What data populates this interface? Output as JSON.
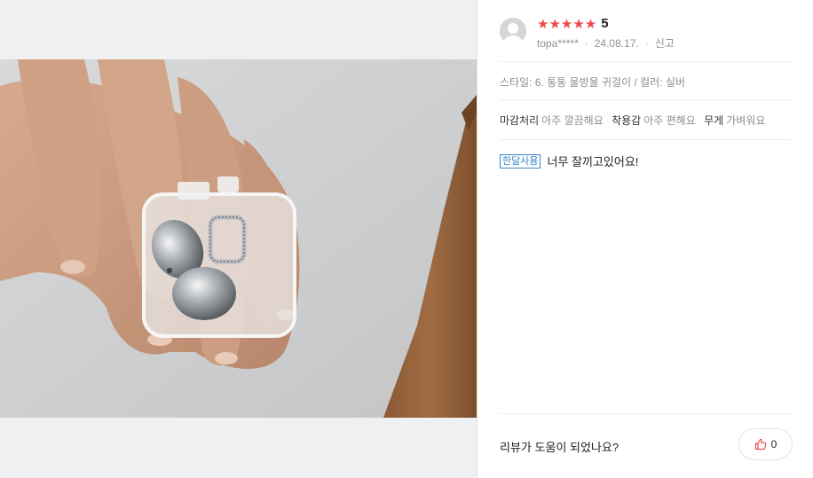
{
  "review": {
    "rating_stars": "★★★★★",
    "rating_value": "5",
    "reviewer": "topa*****",
    "date": "24.08.17.",
    "report_label": "신고",
    "option": "스타일: 6. 통통 물방울 귀걸이 / 컬러: 실버",
    "evaluations": [
      {
        "key": "마감처리",
        "value": "아주 깔끔해요"
      },
      {
        "key": "착용감",
        "value": "아주 편해요"
      },
      {
        "key": "무게",
        "value": "가벼워요"
      }
    ],
    "usage_tag": "한달사용",
    "text": "너무 잘끼고있어요!"
  },
  "footer": {
    "helpful_question": "리뷰가 도움이 되었나요?",
    "like_count": "0"
  },
  "colors": {
    "star": "#ef4a4a",
    "tag": "#3a86c7",
    "muted_text": "#8b8e93",
    "background_left": "#eff0f2"
  },
  "icons": {
    "avatar": "default-avatar-icon",
    "like": "thumbs-up-icon"
  }
}
